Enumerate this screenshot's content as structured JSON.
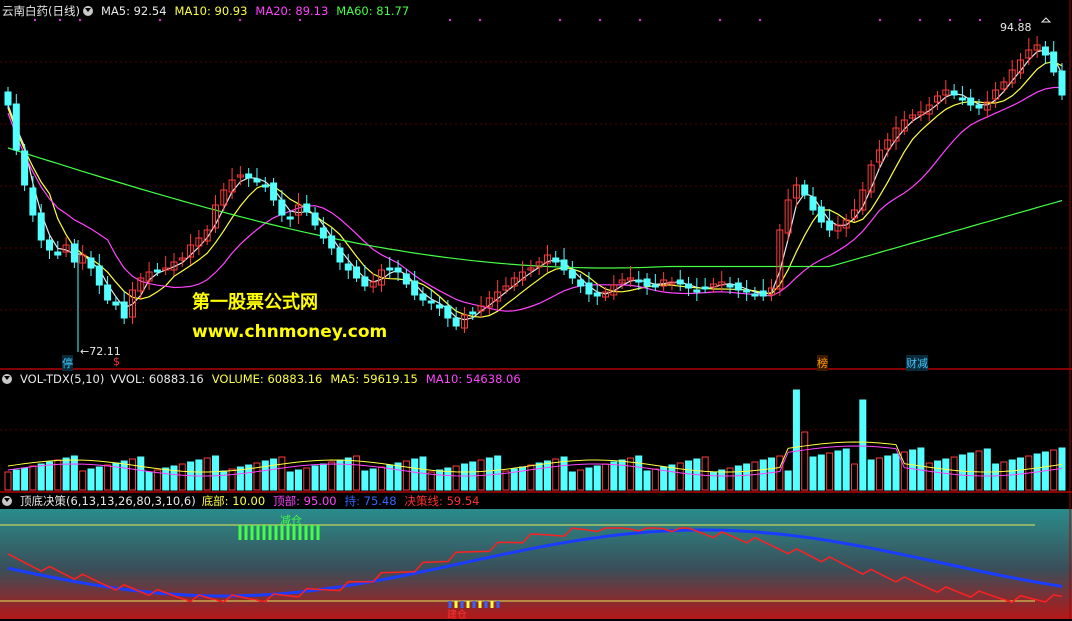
{
  "main": {
    "title": "云南白药(日线)",
    "ma_labels": [
      {
        "text": "MA5: 92.54",
        "color": "#e8e8e8"
      },
      {
        "text": "MA10: 90.93",
        "color": "#ffff44"
      },
      {
        "text": "MA20: 89.13",
        "color": "#ff44ff"
      },
      {
        "text": "MA60: 81.77",
        "color": "#44ff44"
      }
    ],
    "high_label": "94.88",
    "low_label": "←72.11",
    "markers": [
      {
        "text": "停",
        "color": "#40c8ff"
      },
      {
        "text": "$",
        "color": "#ff3030"
      },
      {
        "text": "榜",
        "color": "#ff9900"
      },
      {
        "text": "财减",
        "color": "#40c8ff"
      }
    ],
    "watermark_cn": "第一股票公式网",
    "watermark_url": "www.chnmoney.com"
  },
  "volume": {
    "title": "VOL-TDX(5,10)",
    "labels": [
      {
        "text": "VVOL: 60883.16",
        "color": "#e8e8e8"
      },
      {
        "text": "VOLUME: 60883.16",
        "color": "#ffff44"
      },
      {
        "text": "MA5: 59619.15",
        "color": "#ffff44"
      },
      {
        "text": "MA10: 54638.06",
        "color": "#ff44ff"
      }
    ]
  },
  "indicator": {
    "title": "顶底决策(6,13,13,26,80,3,10,6)",
    "labels": [
      {
        "text": "底部: 10.00",
        "color": "#ffff44"
      },
      {
        "text": "顶部: 95.00",
        "color": "#ff44ff"
      },
      {
        "text": "持: 75.48",
        "color": "#3366ff"
      },
      {
        "text": "决策线: 59.54",
        "color": "#ff3030"
      }
    ],
    "text_top": "减仓",
    "text_bottom": "建仓"
  },
  "colors": {
    "up": "#ff3b3b",
    "down": "#54ffff",
    "ma5": "#e8e8e8",
    "ma10": "#ffff44",
    "ma20": "#ff44ff",
    "ma60": "#44ff44",
    "divider": "#b00000"
  },
  "icons": [
    "collapse-icon",
    "arrow-up-icon"
  ]
}
